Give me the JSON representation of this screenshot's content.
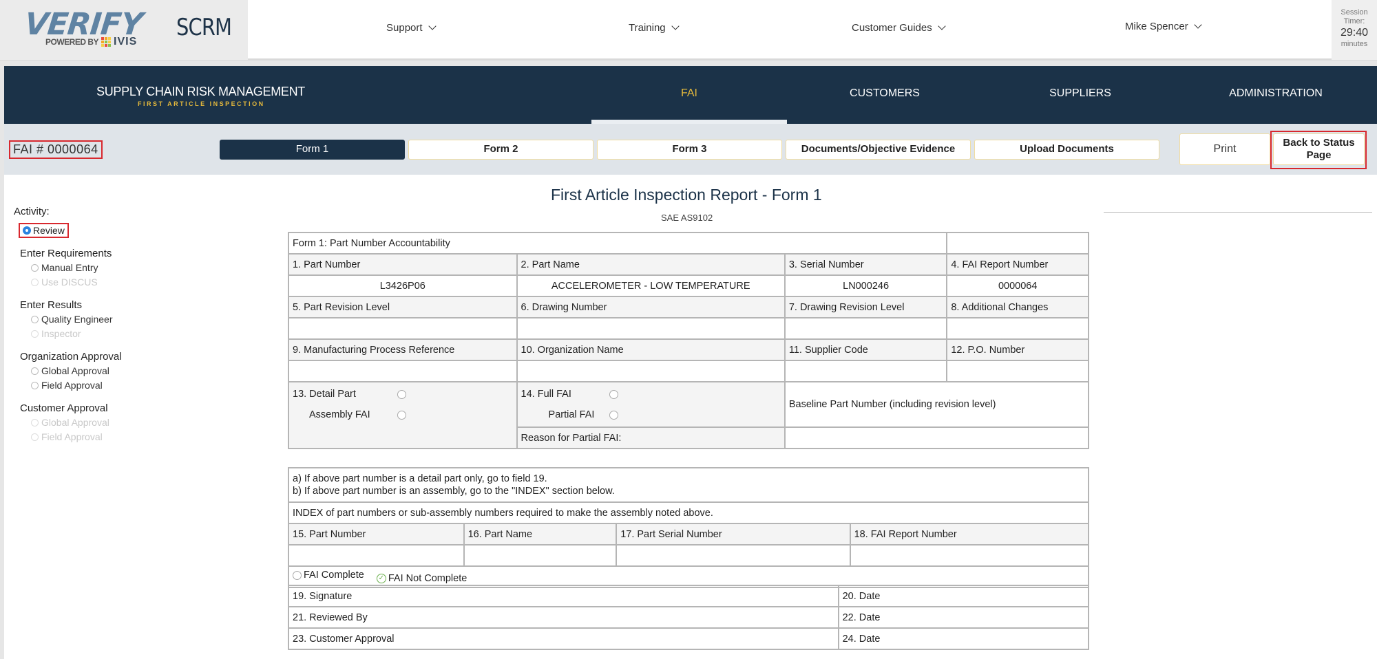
{
  "header": {
    "logo_main": "VERIFY",
    "logo_powered": "POWERED BY",
    "logo_ivis": "IVIS",
    "app_name": "SCRM",
    "nav": [
      {
        "label": "Support"
      },
      {
        "label": "Training"
      },
      {
        "label": "Customer Guides"
      },
      {
        "label": "Mike Spencer"
      }
    ],
    "session": {
      "label_line1": "Session",
      "label_line2": "Timer:",
      "time": "29:40",
      "unit": "minutes"
    }
  },
  "main_nav": {
    "brand_title": "SUPPLY CHAIN RISK MANAGEMENT",
    "brand_subtitle": "FIRST ARTICLE INSPECTION",
    "items": [
      {
        "label": "FAI",
        "active": true
      },
      {
        "label": "CUSTOMERS"
      },
      {
        "label": "SUPPLIERS"
      },
      {
        "label": "ADMINISTRATION"
      }
    ],
    "accent_color": "#e5b93c",
    "background_color": "#1b3248"
  },
  "toolbar": {
    "fai_number": "FAI # 0000064",
    "tabs": [
      {
        "label": "Form 1",
        "active": true
      },
      {
        "label": "Form 2"
      },
      {
        "label": "Form 3"
      },
      {
        "label": "Documents/Objective Evidence"
      },
      {
        "label": "Upload Documents"
      }
    ],
    "print_label": "Print",
    "back_label_line1": "Back to Status",
    "back_label_line2": "Page"
  },
  "sidebar": {
    "activity_label": "Activity:",
    "review_label": "Review",
    "groups": [
      {
        "title": "Enter Requirements",
        "options": [
          {
            "label": "Manual Entry",
            "disabled": false
          },
          {
            "label": "Use DISCUS",
            "disabled": true
          }
        ]
      },
      {
        "title": "Enter Results",
        "options": [
          {
            "label": "Quality Engineer",
            "disabled": false
          },
          {
            "label": "Inspector",
            "disabled": true
          }
        ]
      },
      {
        "title": "Organization Approval",
        "options": [
          {
            "label": "Global Approval",
            "disabled": false
          },
          {
            "label": "Field Approval",
            "disabled": false
          }
        ]
      },
      {
        "title": "Customer Approval",
        "options": [
          {
            "label": "Global Approval",
            "disabled": true
          },
          {
            "label": "Field Approval",
            "disabled": true
          }
        ]
      }
    ]
  },
  "report": {
    "title": "First Article Inspection Report - Form 1",
    "subtitle": "SAE AS9102",
    "section_title": "Form 1: Part Number Accountability",
    "fields": {
      "f1_label": "1. Part Number",
      "f1_value": "L3426P06",
      "f2_label": "2. Part Name",
      "f2_value": "ACCELEROMETER - LOW TEMPERATURE",
      "f3_label": "3. Serial Number",
      "f3_value": "LN000246",
      "f4_label": "4. FAI Report Number",
      "f4_value": "0000064",
      "f5_label": "5. Part Revision Level",
      "f5_value": "",
      "f6_label": "6. Drawing Number",
      "f6_value": "",
      "f7_label": "7. Drawing Revision Level",
      "f7_value": "",
      "f8_label": "8. Additional Changes",
      "f8_value": "",
      "f9_label": "9. Manufacturing Process Reference",
      "f9_value": "",
      "f10_label": "10. Organization Name",
      "f10_value": "",
      "f11_label": "11. Supplier Code",
      "f11_value": "",
      "f12_label": "12. P.O. Number",
      "f12_value": "",
      "f13_detail": "13. Detail Part",
      "f13_assembly": "Assembly FAI",
      "f14_full": "14. Full FAI",
      "f14_partial": "Partial FAI",
      "baseline_label": "Baseline Part Number (including revision level)",
      "reason_label": "Reason for Partial FAI:"
    },
    "instructions_a": "a) If above part number is a detail part only, go to field 19.",
    "instructions_b": "b) If above part number is an assembly, go to the \"INDEX\" section below.",
    "index_note": "INDEX of part numbers or sub-assembly numbers required to make the assembly noted above.",
    "index_columns": [
      "15. Part Number",
      "16. Part Name",
      "17. Part Serial Number",
      "18. FAI Report Number"
    ],
    "fai_complete_label": "FAI Complete",
    "fai_not_complete_label": "FAI Not Complete",
    "fai_status_selected": "FAI Not Complete",
    "signoff": [
      {
        "left": "19. Signature",
        "right": "20. Date"
      },
      {
        "left": "21. Reviewed By",
        "right": "22. Date"
      },
      {
        "left": "23. Customer Approval",
        "right": "24. Date"
      }
    ]
  }
}
